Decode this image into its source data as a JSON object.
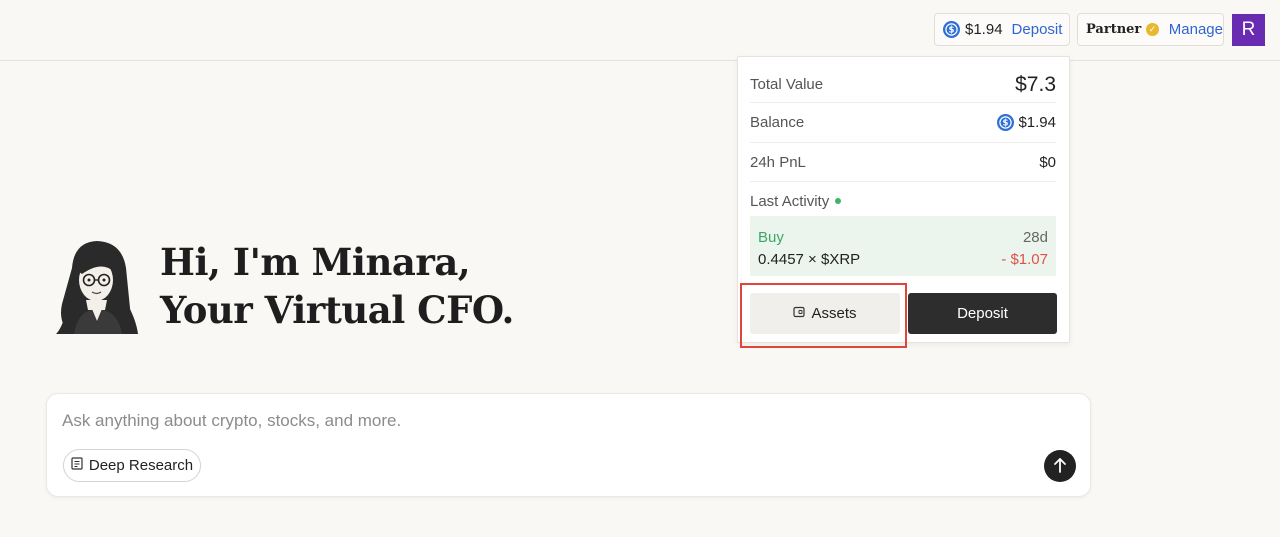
{
  "header": {
    "wallet": {
      "amount": "$1.94",
      "deposit_label": "Deposit",
      "icon": "usdc-coin-icon",
      "accent": "#2f66d3"
    },
    "partner": {
      "label": "Partner",
      "badge_icon": "verified-badge-icon",
      "manage_label": "Manage"
    },
    "avatar_initial": "R",
    "avatar_color": "#6a2bb3"
  },
  "portfolio_panel": {
    "total_value_label": "Total Value",
    "total_value": "$7.3",
    "balance_label": "Balance",
    "balance": "$1.94",
    "pnl_label": "24h PnL",
    "pnl": "$0",
    "last_activity_label": "Last Activity",
    "activity": {
      "type": "Buy",
      "age": "28d",
      "quantity": "0.4457 × $XRP",
      "pnl": "- $1.07"
    },
    "assets_button": "Assets",
    "deposit_button": "Deposit",
    "colors": {
      "positive": "#3ba766",
      "negative": "#e05247"
    }
  },
  "hero": {
    "line1": "Hi, I'm Minara,",
    "line2": "Your Virtual CFO."
  },
  "chat": {
    "placeholder": "Ask anything about crypto, stocks, and more.",
    "deep_research_label": "Deep Research",
    "send_icon": "arrow-up-icon"
  }
}
